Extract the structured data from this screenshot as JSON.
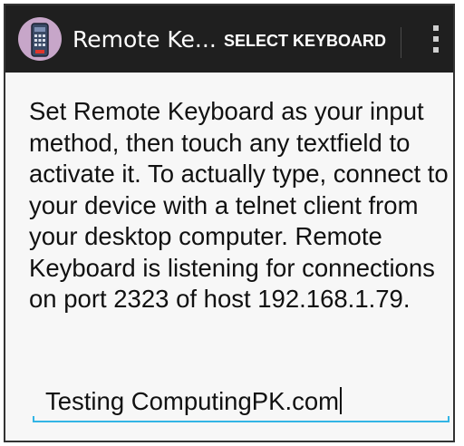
{
  "action_bar": {
    "app_title": "Remote Ke...",
    "action_button_label": "SELECT KEYBOARD",
    "app_icon": "remote-control-icon",
    "overflow_icon": "overflow-menu-icon"
  },
  "main": {
    "instructions": "Set Remote Keyboard as your input method, then touch any textfield to activate it. To actually type, connect to your device with a telnet client from your desktop computer. Remote Keyboard is listening for connections on port 2323 of host 192.168.1.79.",
    "text_field_value": "Testing ComputingPK.com"
  },
  "colors": {
    "action_bar_bg": "#1f1f1f",
    "content_bg": "#f7f7f7",
    "accent": "#33b5e5",
    "icon_bg": "#c7a6c9"
  }
}
